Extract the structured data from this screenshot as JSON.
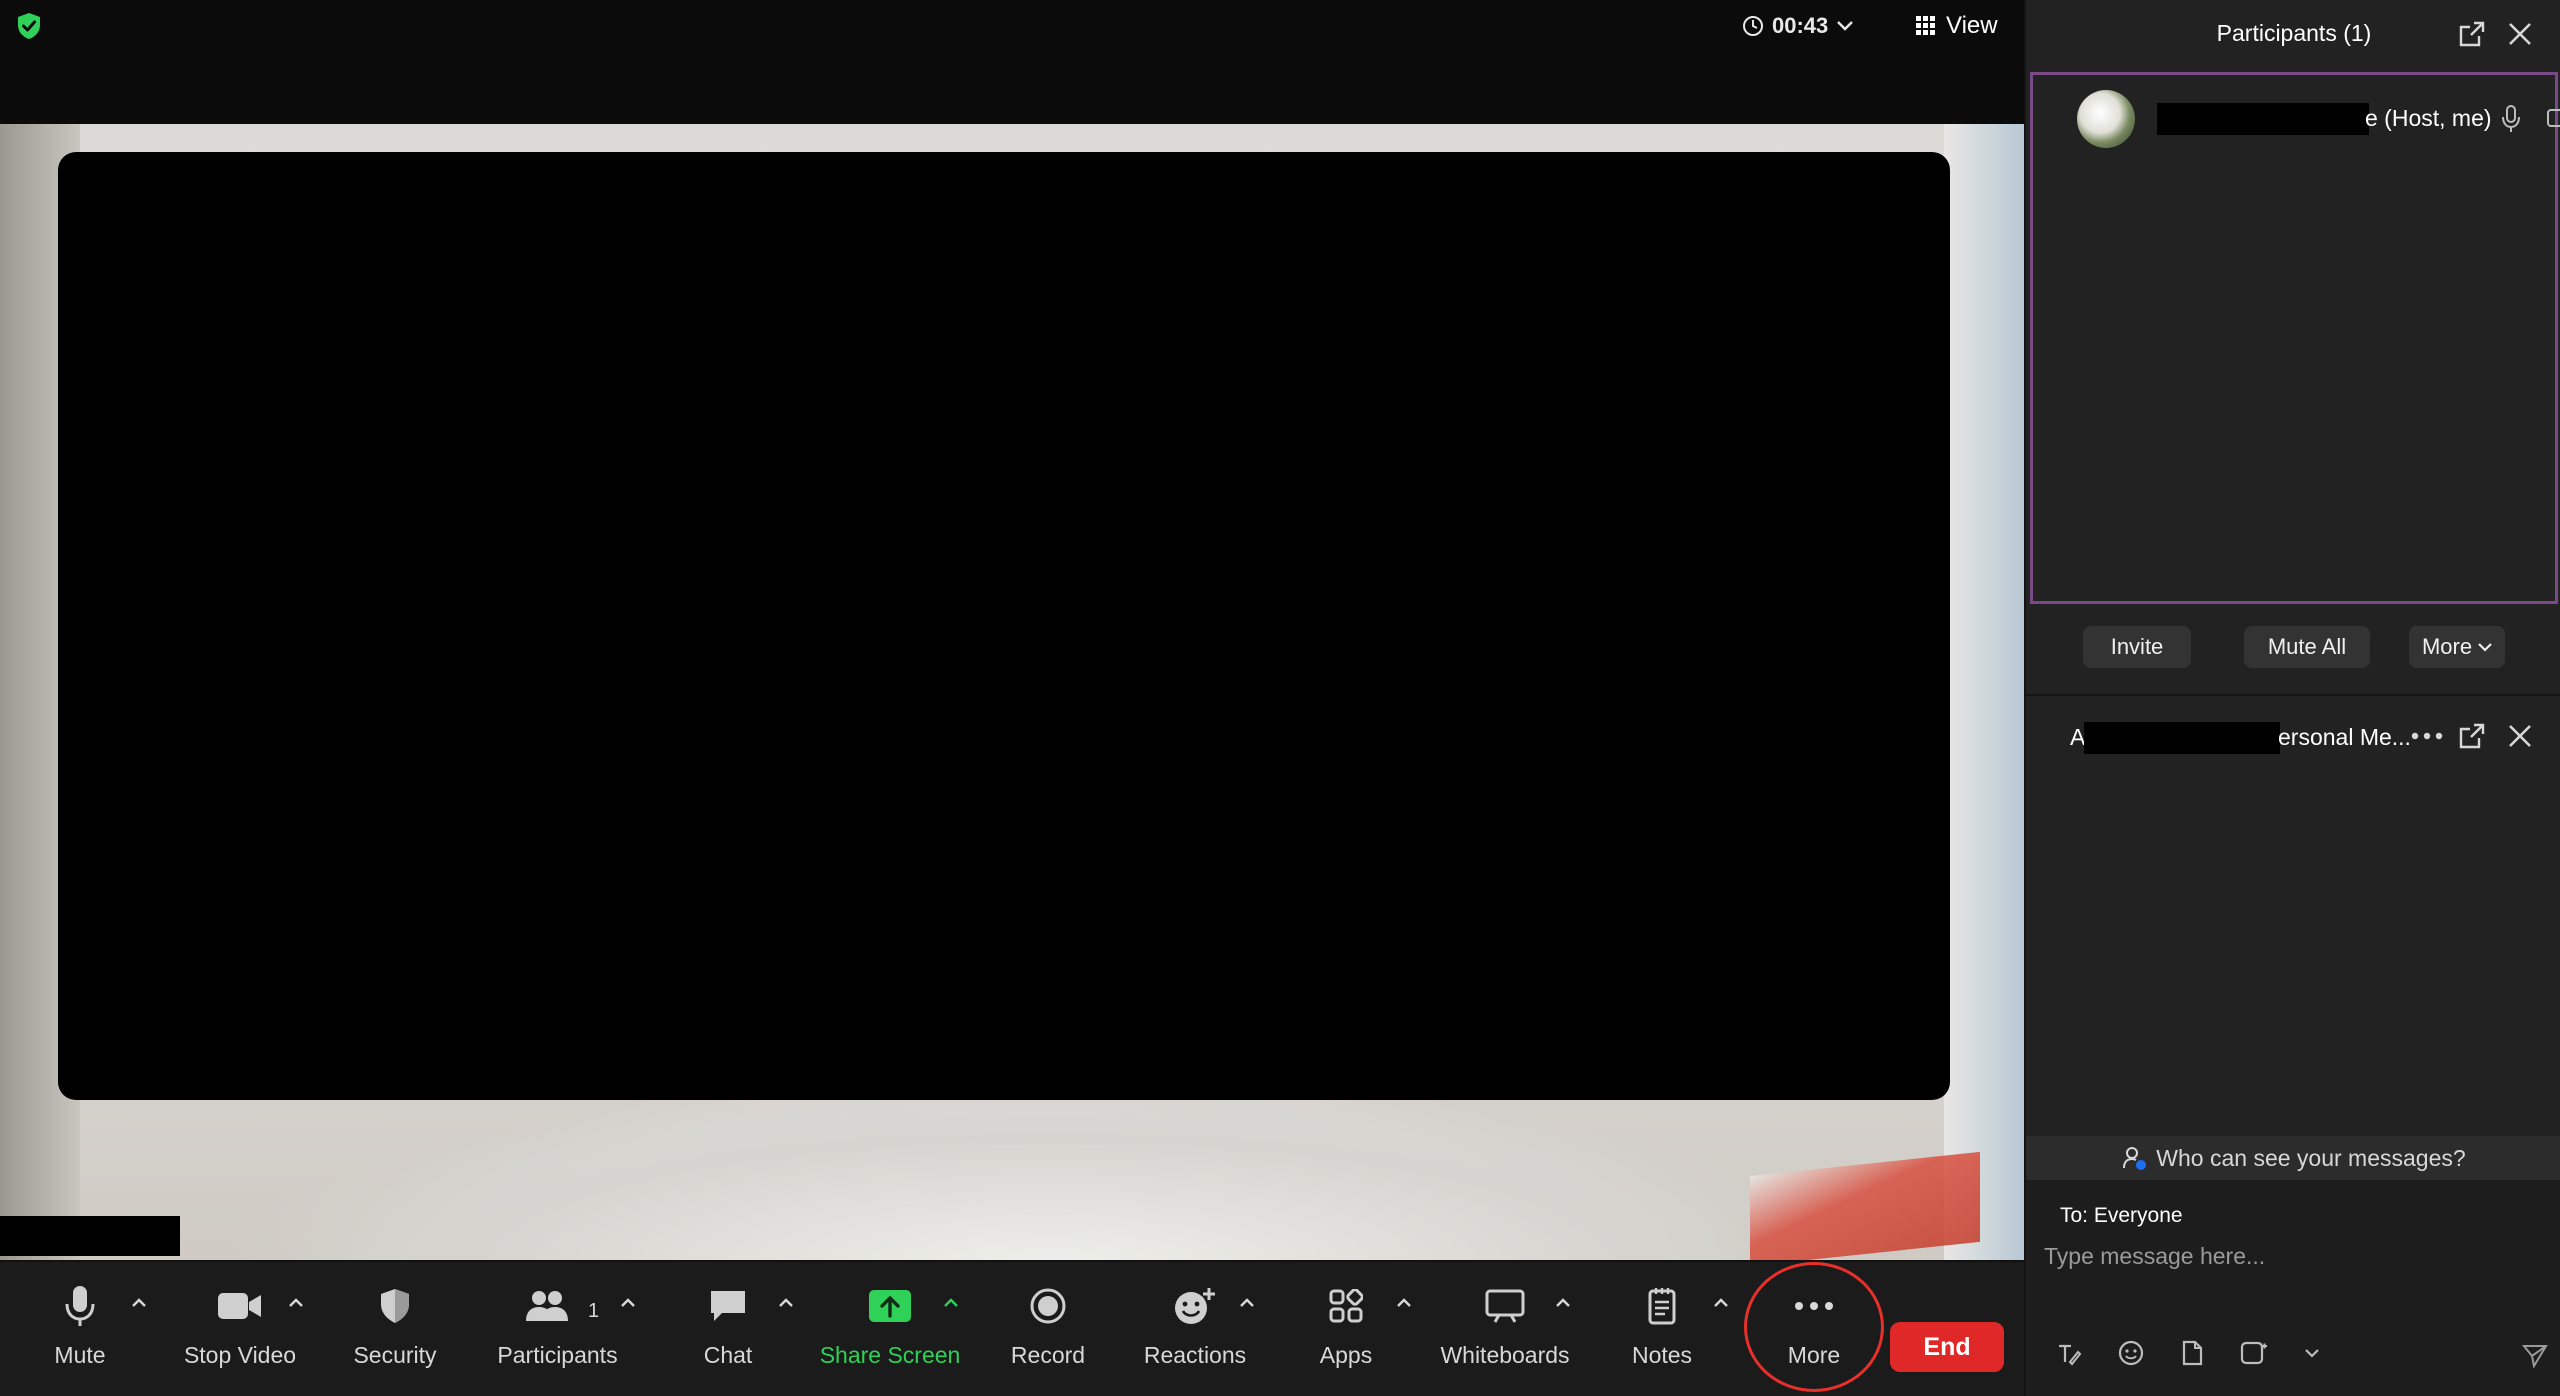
{
  "meeting": {
    "timer": "00:43",
    "view_label": "View"
  },
  "toolbar": {
    "mute": "Mute",
    "stop_video": "Stop Video",
    "security": "Security",
    "participants": "Participants",
    "participants_count": "1",
    "chat": "Chat",
    "share_screen": "Share Screen",
    "record": "Record",
    "reactions": "Reactions",
    "apps": "Apps",
    "whiteboards": "Whiteboards",
    "notes": "Notes",
    "more": "More",
    "end": "End"
  },
  "participants_panel": {
    "title": "Participants (1)",
    "participant_name_suffix": "e (Host, me)",
    "actions": {
      "invite": "Invite",
      "mute_all": "Mute All",
      "more": "More"
    }
  },
  "chat_panel": {
    "title_prefix": "A",
    "title_suffix": "ersonal Me...",
    "who_can_see": "Who can see your messages?",
    "to_label": "To: Everyone",
    "input_placeholder": "Type message here..."
  },
  "colors": {
    "accent_green": "#30d158",
    "end_red": "#e02828",
    "highlight_ring": "#e8302a",
    "participants_border": "#7a4a86"
  }
}
